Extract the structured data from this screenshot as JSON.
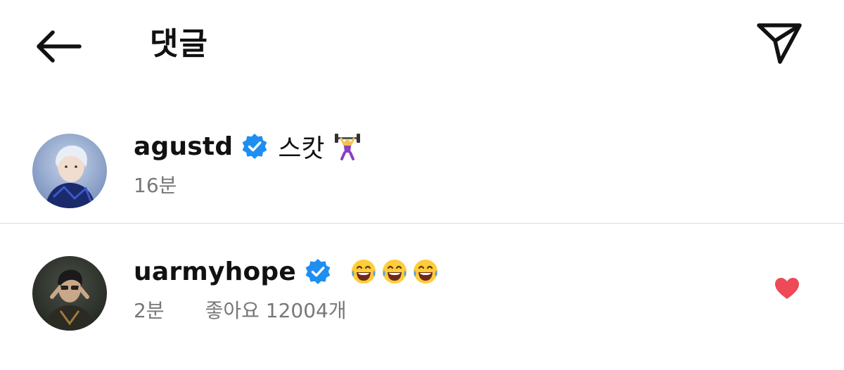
{
  "header": {
    "title": "댓글",
    "back_icon": "arrow-left-icon",
    "share_icon": "paper-plane-icon"
  },
  "colors": {
    "verified_blue": "#1f8ef1",
    "like_red": "#ed4956",
    "meta_gray": "#777777",
    "divider": "#d9d9d9"
  },
  "comments": [
    {
      "username": "agustd",
      "verified": true,
      "text": "스캇",
      "emoji": [
        "weightlifter-emoji"
      ],
      "time": "16분",
      "likes": "",
      "liked": false
    },
    {
      "username": "uarmyhope",
      "verified": true,
      "text": "",
      "emoji": [
        "tears-of-joy-emoji",
        "tears-of-joy-emoji",
        "tears-of-joy-emoji"
      ],
      "time": "2분",
      "likes": "좋아요 12004개",
      "liked": true
    }
  ]
}
